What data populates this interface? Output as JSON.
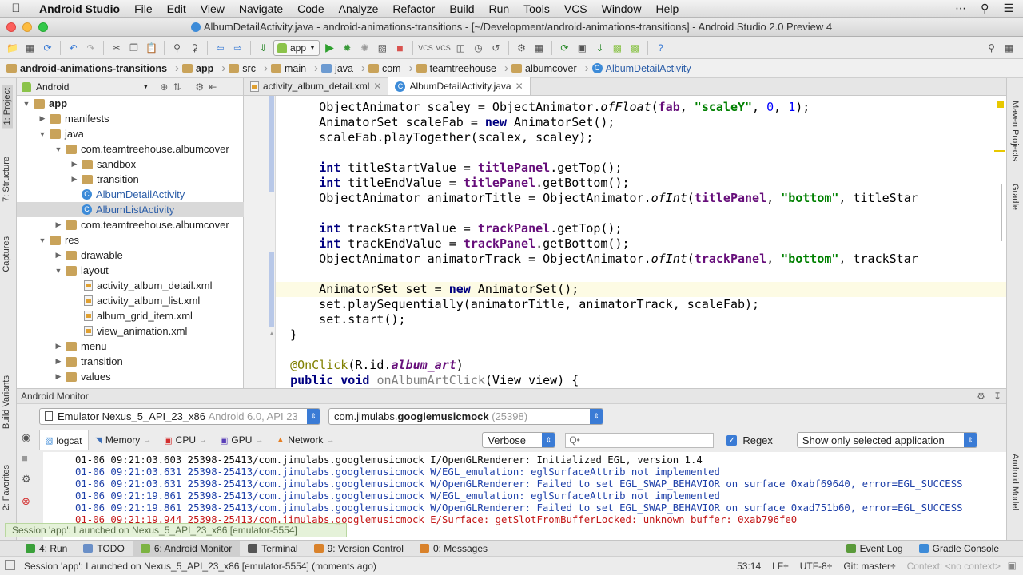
{
  "menubar": {
    "items": [
      "Android Studio",
      "File",
      "Edit",
      "View",
      "Navigate",
      "Code",
      "Analyze",
      "Refactor",
      "Build",
      "Run",
      "Tools",
      "VCS",
      "Window",
      "Help"
    ]
  },
  "window": {
    "title": "AlbumDetailActivity.java - android-animations-transitions - [~/Development/android-animations-transitions] - Android Studio 2.0 Preview 4"
  },
  "toolbar": {
    "run_config": "app"
  },
  "breadcrumb": [
    "android-animations-transitions",
    "app",
    "src",
    "main",
    "java",
    "com",
    "teamtreehouse",
    "albumcover",
    "AlbumDetailActivity"
  ],
  "project_panel": {
    "view_mode": "Android",
    "tree": [
      {
        "label": "app",
        "depth": 0,
        "icon": "folder",
        "open": true,
        "bold": true
      },
      {
        "label": "manifests",
        "depth": 1,
        "icon": "folder",
        "open": false
      },
      {
        "label": "java",
        "depth": 1,
        "icon": "folder",
        "open": true
      },
      {
        "label": "com.teamtreehouse.albumcover",
        "depth": 2,
        "icon": "package",
        "open": true
      },
      {
        "label": "sandbox",
        "depth": 3,
        "icon": "package",
        "open": false
      },
      {
        "label": "transition",
        "depth": 3,
        "icon": "package",
        "open": false
      },
      {
        "label": "AlbumDetailActivity",
        "depth": 3,
        "icon": "class",
        "leaf": true,
        "blue": true
      },
      {
        "label": "AlbumListActivity",
        "depth": 3,
        "icon": "class",
        "leaf": true,
        "blue": true,
        "selected": true
      },
      {
        "label": "com.teamtreehouse.albumcover",
        "depth": 2,
        "icon": "package",
        "open": false
      },
      {
        "label": "res",
        "depth": 1,
        "icon": "folder",
        "open": true
      },
      {
        "label": "drawable",
        "depth": 2,
        "icon": "folder",
        "open": false
      },
      {
        "label": "layout",
        "depth": 2,
        "icon": "folder",
        "open": true
      },
      {
        "label": "activity_album_detail.xml",
        "depth": 3,
        "icon": "xml",
        "leaf": true
      },
      {
        "label": "activity_album_list.xml",
        "depth": 3,
        "icon": "xml",
        "leaf": true
      },
      {
        "label": "album_grid_item.xml",
        "depth": 3,
        "icon": "xml",
        "leaf": true
      },
      {
        "label": "view_animation.xml",
        "depth": 3,
        "icon": "xml",
        "leaf": true
      },
      {
        "label": "menu",
        "depth": 2,
        "icon": "folder",
        "open": false
      },
      {
        "label": "transition",
        "depth": 2,
        "icon": "folder",
        "open": false
      },
      {
        "label": "values",
        "depth": 2,
        "icon": "folder",
        "open": false
      }
    ]
  },
  "editor": {
    "tabs": [
      {
        "label": "activity_album_detail.xml",
        "active": false
      },
      {
        "label": "AlbumDetailActivity.java",
        "active": true
      }
    ]
  },
  "side_tabs": {
    "left": [
      "1: Project",
      "7: Structure",
      "Captures",
      "Build Variants",
      "2: Favorites"
    ],
    "right": [
      "Maven Projects",
      "Gradle",
      "Android Model"
    ]
  },
  "monitor": {
    "title": "Android Monitor",
    "device": "Emulator Nexus_5_API_23_x86",
    "device_detail": "Android 6.0, API 23",
    "process": "com.jimulabs.",
    "process_bold": "googlemusicmock",
    "process_pid": "(25398)",
    "tabs": [
      "logcat",
      "Memory",
      "CPU",
      "GPU",
      "Network"
    ],
    "log_level": "Verbose",
    "search_placeholder": "Q•",
    "regex_label": "Regex",
    "filter": "Show only selected application",
    "log_lines": [
      {
        "level": "i",
        "text": "01-06 09:21:03.603 25398-25413/com.jimulabs.googlemusicmock I/OpenGLRenderer: Initialized EGL, version 1.4"
      },
      {
        "level": "w",
        "text": "01-06 09:21:03.631 25398-25413/com.jimulabs.googlemusicmock W/EGL_emulation: eglSurfaceAttrib not implemented"
      },
      {
        "level": "w",
        "text": "01-06 09:21:03.631 25398-25413/com.jimulabs.googlemusicmock W/OpenGLRenderer: Failed to set EGL_SWAP_BEHAVIOR on surface 0xabf69640, error=EGL_SUCCESS"
      },
      {
        "level": "w",
        "text": "01-06 09:21:19.861 25398-25413/com.jimulabs.googlemusicmock W/EGL_emulation: eglSurfaceAttrib not implemented"
      },
      {
        "level": "w",
        "text": "01-06 09:21:19.861 25398-25413/com.jimulabs.googlemusicmock W/OpenGLRenderer: Failed to set EGL_SWAP_BEHAVIOR on surface 0xad751b60, error=EGL_SUCCESS"
      },
      {
        "level": "e",
        "text": "01-06 09:21:19.944 25398-25413/com.jimulabs.googlemusicmock E/Surface: getSlotFromBufferLocked: unknown buffer: 0xab796fe0"
      }
    ],
    "balloon": "Session 'app': Launched on Nexus_5_API_23_x86 [emulator-5554]"
  },
  "bottom_tools": [
    {
      "label": "4: Run",
      "active": false,
      "color": "#3aa03a"
    },
    {
      "label": "TODO",
      "active": false,
      "color": "#6a8fc7"
    },
    {
      "label": "6: Android Monitor",
      "active": true,
      "color": "#7cb342"
    },
    {
      "label": "Terminal",
      "active": false,
      "color": "#555555"
    },
    {
      "label": "9: Version Control",
      "active": false,
      "color": "#d9822b"
    },
    {
      "label": "0: Messages",
      "active": false,
      "color": "#d9822b"
    }
  ],
  "bottom_tools_right": [
    "Event Log",
    "Gradle Console"
  ],
  "status": {
    "message": "Session 'app': Launched on Nexus_5_API_23_x86 [emulator-5554] (moments ago)",
    "position": "53:14",
    "line_sep": "LF÷",
    "encoding": "UTF-8÷",
    "git": "Git: master÷",
    "context": "Context: <no context>"
  }
}
